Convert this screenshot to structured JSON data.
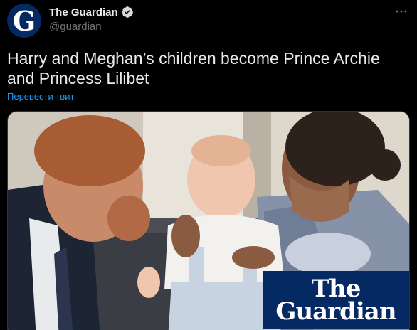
{
  "account": {
    "avatar_letter": "G",
    "display_name": "The Guardian",
    "handle": "@guardian",
    "verified": true,
    "avatar_color": "#052962"
  },
  "tweet": {
    "text": "Harry and Meghan’s children become Prince Archie and Princess Lilibet",
    "translate_label": "Перевести твит"
  },
  "media": {
    "logo_line_1": "The",
    "logo_line_2": "Guardian",
    "logo_color": "#052962"
  },
  "icons": {
    "more": "more-icon",
    "verified": "verified-badge-icon"
  },
  "colors": {
    "background": "#000000",
    "text": "#e7e9ea",
    "secondary": "#71767b",
    "link": "#1d9bf0"
  }
}
